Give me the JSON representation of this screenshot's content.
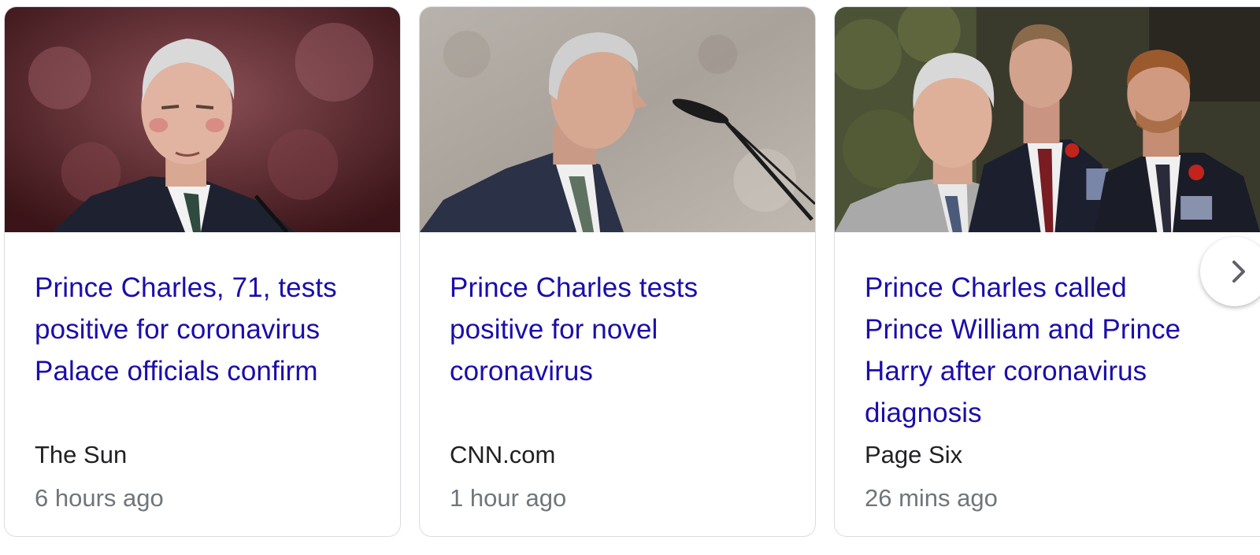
{
  "news_carousel": {
    "cards": [
      {
        "headline": "Prince Charles, 71, tests positive for coronavirus Palace officials confirm",
        "source": "The Sun",
        "time": "6 hours ago"
      },
      {
        "headline": "Prince Charles tests positive for novel coronavirus",
        "source": "CNN.com",
        "time": "1 hour ago"
      },
      {
        "headline": "Prince Charles called Prince William and Prince Harry after coronavirus diagnosis",
        "source": "Page Six",
        "time": "26 mins ago"
      }
    ],
    "next_button_icon": "chevron-right-icon"
  },
  "colors": {
    "headline_link": "#1a0dab",
    "source_text": "#202124",
    "time_text": "#70757a",
    "card_border": "#dadce0"
  }
}
